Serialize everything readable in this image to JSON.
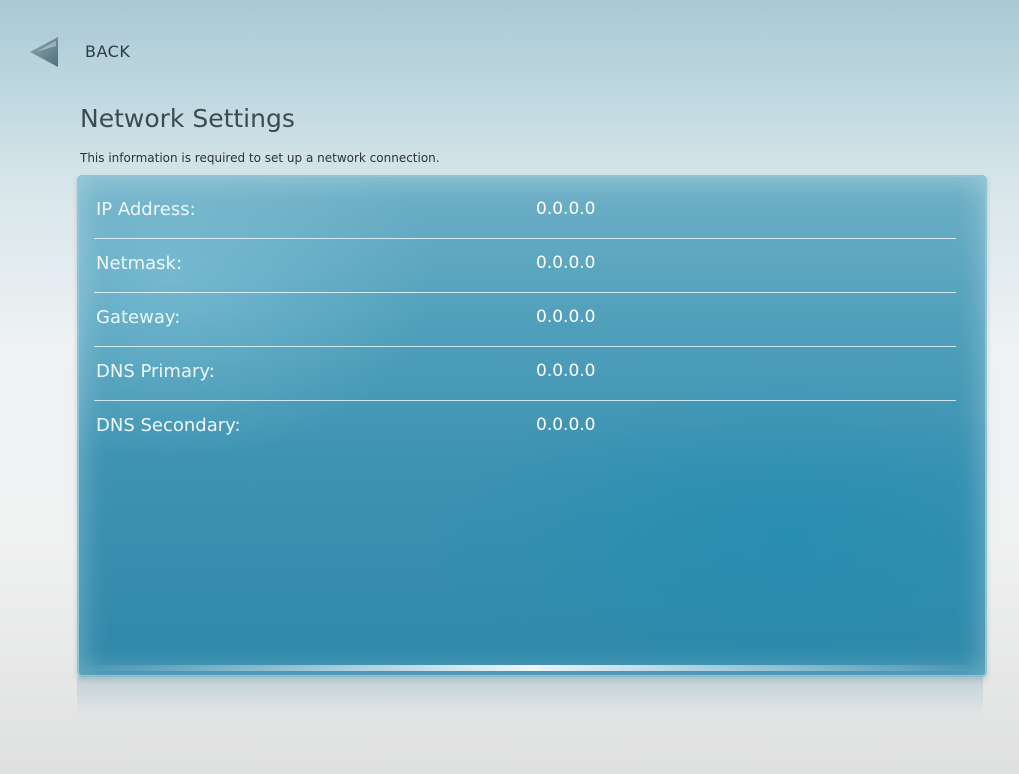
{
  "header": {
    "back_label": "BACK",
    "title": "Network Settings",
    "subtitle": "This information is required to set up a network connection."
  },
  "settings": [
    {
      "label": "IP Address:",
      "value": "0.0.0.0"
    },
    {
      "label": "Netmask:",
      "value": "0.0.0.0"
    },
    {
      "label": "Gateway:",
      "value": "0.0.0.0"
    },
    {
      "label": "DNS Primary:",
      "value": "0.0.0.0"
    },
    {
      "label": "DNS Secondary:",
      "value": "0.0.0.0"
    }
  ],
  "icons": {
    "back": "back-arrow-icon"
  },
  "colors": {
    "panel": "#3d92b1",
    "accent": "#5a8292"
  }
}
